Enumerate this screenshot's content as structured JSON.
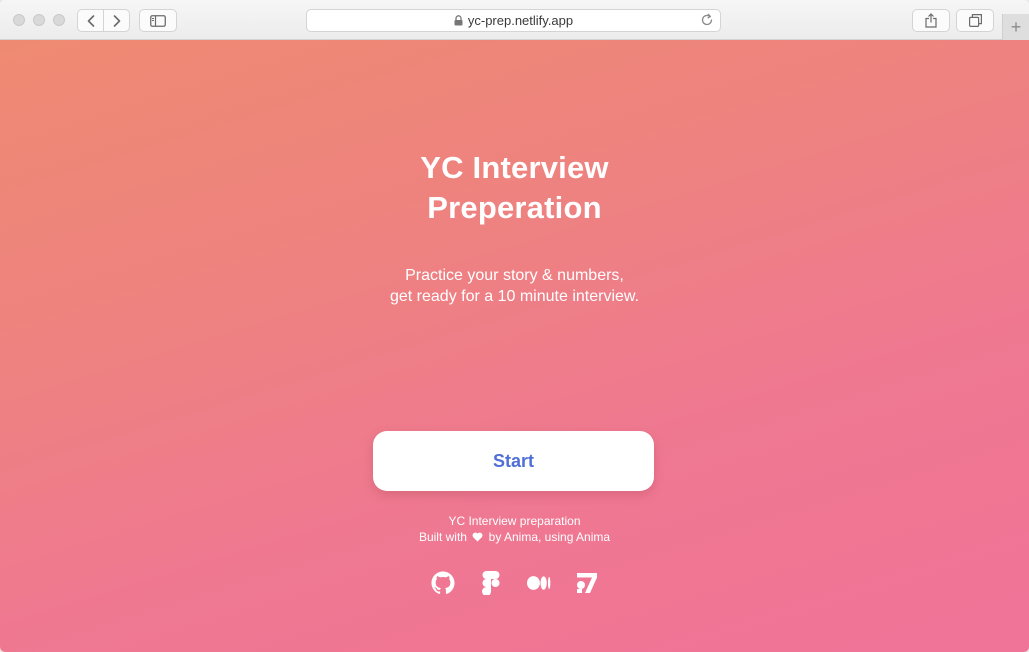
{
  "browser": {
    "url": "yc-prep.netlify.app",
    "new_tab_label": "+"
  },
  "page": {
    "title_line1": "YC Interview",
    "title_line2": "Preperation",
    "subtitle_line1": "Practice your story & numbers,",
    "subtitle_line2": "get ready for a 10 minute interview.",
    "start_label": "Start",
    "footer_line1": "YC Interview preparation",
    "footer_built_with": "Built with",
    "footer_by": "by Anima, using Anima"
  },
  "social_icons": [
    "github-icon",
    "figma-icon",
    "medium-icon",
    "anima-icon"
  ],
  "colors": {
    "gradient_start": "#ef8a72",
    "gradient_end": "#f07398",
    "button_text": "#4f6fd6",
    "text": "#ffffff"
  }
}
